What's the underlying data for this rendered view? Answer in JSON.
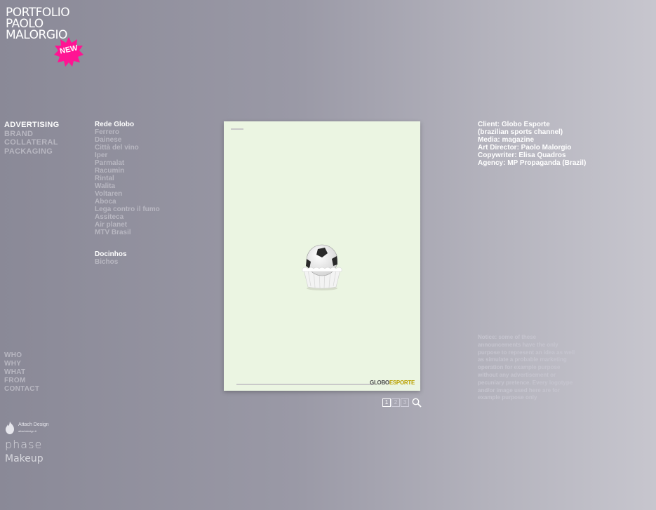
{
  "logo": {
    "line1": "PORTFOLIO",
    "line2": "PAOLO",
    "line3": "MALORGIO",
    "badge": "NEW",
    "badge_color": "#ff1493"
  },
  "categories": [
    {
      "label": "ADVERTISING",
      "active": true
    },
    {
      "label": "BRAND",
      "active": false
    },
    {
      "label": "COLLATERAL",
      "active": false
    },
    {
      "label": "PACKAGING",
      "active": false
    }
  ],
  "projects_group1": [
    {
      "label": "Rede Globo",
      "active": true
    },
    {
      "label": "Ferrero",
      "active": false
    },
    {
      "label": "Dainese",
      "active": false
    },
    {
      "label": "Città del vino",
      "active": false
    },
    {
      "label": "Iper",
      "active": false
    },
    {
      "label": "Parmalat",
      "active": false
    },
    {
      "label": "Racumin",
      "active": false
    },
    {
      "label": "Rintal",
      "active": false
    },
    {
      "label": "Walita",
      "active": false
    },
    {
      "label": "Voltaren",
      "active": false
    },
    {
      "label": "Aboca",
      "active": false
    },
    {
      "label": "Lega contro il fumo",
      "active": false
    },
    {
      "label": "Assiteca",
      "active": false
    },
    {
      "label": "Air planet",
      "active": false
    },
    {
      "label": "MTV Brasil",
      "active": false
    }
  ],
  "projects_group2": [
    {
      "label": "Docinhos",
      "active": true
    },
    {
      "label": "Bichos",
      "active": false
    }
  ],
  "poster": {
    "background": "#ebf5e2",
    "brand_part1": "GLOBO",
    "brand_part2": "ESPORTE",
    "subject_icon": "soccer-cupcake"
  },
  "pager": {
    "pages": [
      "1",
      "2",
      "3"
    ],
    "current": "1",
    "zoom_icon": "magnifier-icon"
  },
  "info": [
    "Client: Globo Esporte",
    "(brazilian sports channel)",
    "Media: magazine",
    "Art Director: Paolo Malorgio",
    "Copywriter: Elisa Quadros",
    "Agency: MP Propaganda (Brazil)"
  ],
  "notice": "Notice: some of these announcements have the only purpose to represent an idea as well as simulate a probable marketing operation for example purpose without any advertisement or pecuniary pretence. Every logotype and/or image used here are for example purpose only",
  "nav": [
    "WHO",
    "WHY",
    "WHAT",
    "FROM",
    "CONTACT"
  ],
  "partners": {
    "attach": "Attach Design",
    "attach_sub": "attachdesign.it",
    "phase": "phase",
    "makeup": "Makeup"
  }
}
